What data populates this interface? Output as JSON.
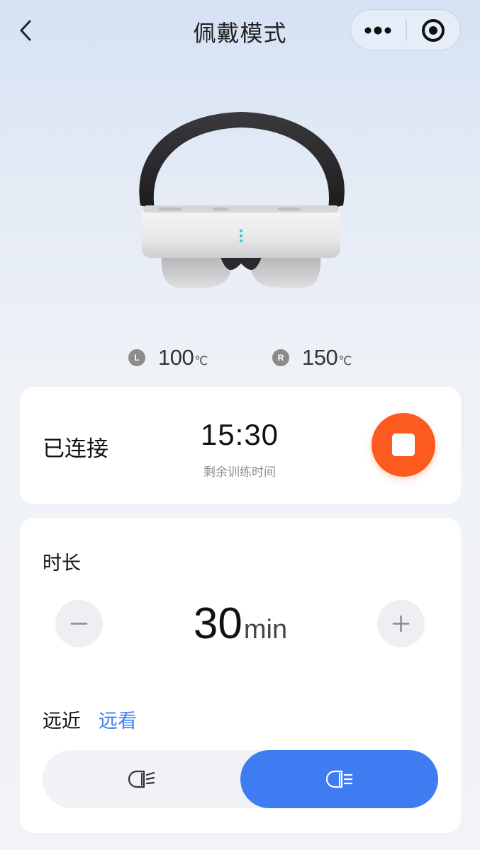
{
  "header": {
    "title": "佩戴模式",
    "icons": [
      "chevron-left-icon",
      "more-dots-icon",
      "target-icon"
    ]
  },
  "temperatures": {
    "left": {
      "badge": "L",
      "value": "100",
      "unit": "℃"
    },
    "right": {
      "badge": "R",
      "value": "150",
      "unit": "℃"
    }
  },
  "status_card": {
    "status": "已连接",
    "timer": "15:30",
    "caption": "剩余训练时间",
    "stop_icon": "stop-icon"
  },
  "settings_card": {
    "duration_label": "时长",
    "duration_value": "30",
    "duration_unit": "min",
    "distance_label": "远近",
    "distance_value": "远看",
    "distance_options": [
      "near-beam-icon",
      "far-beam-icon"
    ],
    "selected_option": "far"
  },
  "colors": {
    "accent_blue": "#3f7cf2",
    "stop_orange": "#fc5a1e",
    "badge_grey": "#8b8b8b"
  }
}
